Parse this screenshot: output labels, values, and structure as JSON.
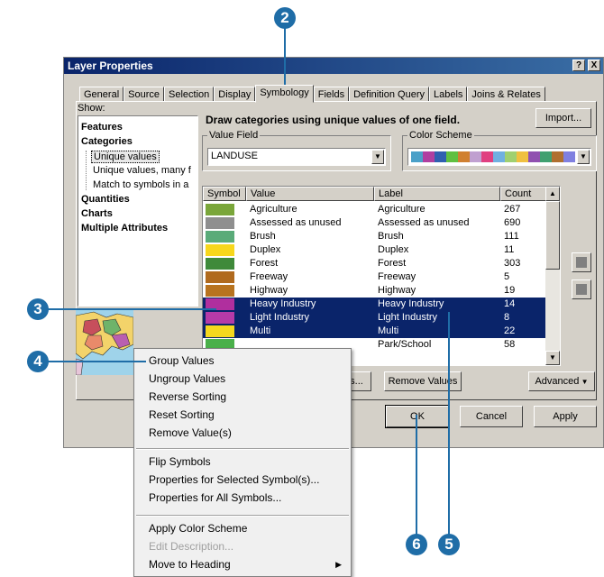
{
  "window": {
    "title": "Layer Properties",
    "help_btn": "?",
    "close_btn": "X"
  },
  "tabs": [
    "General",
    "Source",
    "Selection",
    "Display",
    "Symbology",
    "Fields",
    "Definition Query",
    "Labels",
    "Joins & Relates"
  ],
  "show": {
    "label": "Show:",
    "items": [
      "Features",
      "Categories",
      "Unique values",
      "Unique values, many f",
      "Match to symbols in a",
      "Quantities",
      "Charts",
      "Multiple Attributes"
    ]
  },
  "description": "Draw categories using unique values of one field.",
  "import_label": "Import...",
  "value_field": {
    "label": "Value Field",
    "value": "LANDUSE"
  },
  "color_scheme": {
    "label": "Color Scheme",
    "colors": [
      "#4aa0c8",
      "#b03fa0",
      "#3060b0",
      "#60c040",
      "#d08030",
      "#c0a0d0",
      "#e04080",
      "#70b0e0",
      "#a0d070",
      "#f0c040",
      "#9050b0",
      "#40a070",
      "#b07030",
      "#8080e0"
    ]
  },
  "table": {
    "headers": [
      "Symbol",
      "Value",
      "Label",
      "Count"
    ],
    "rows": [
      {
        "color": "#7aa63a",
        "value": "Agriculture",
        "label": "Agriculture",
        "count": "267",
        "selected": false
      },
      {
        "color": "#8f8f8f",
        "value": "Assessed as unused",
        "label": "Assessed as unused",
        "count": "690",
        "selected": false
      },
      {
        "color": "#5aab79",
        "value": "Brush",
        "label": "Brush",
        "count": "111",
        "selected": false
      },
      {
        "color": "#f7d71c",
        "value": "Duplex",
        "label": "Duplex",
        "count": "11",
        "selected": false
      },
      {
        "color": "#3f8a3a",
        "value": "Forest",
        "label": "Forest",
        "count": "303",
        "selected": false
      },
      {
        "color": "#b06a1e",
        "value": "Freeway",
        "label": "Freeway",
        "count": "5",
        "selected": false
      },
      {
        "color": "#b8731f",
        "value": "Highway",
        "label": "Highway",
        "count": "19",
        "selected": false
      },
      {
        "color": "#b02f9e",
        "value": "Heavy Industry",
        "label": "Heavy Industry",
        "count": "14",
        "selected": true
      },
      {
        "color": "#b63aa8",
        "value": "Light Industry",
        "label": "Light Industry",
        "count": "8",
        "selected": true
      },
      {
        "color": "#f5d81e",
        "value": "Multi",
        "label": "Multi",
        "count": "22",
        "selected": true
      },
      {
        "color": "#4ab04a",
        "value": "",
        "label": "Park/School",
        "count": "58",
        "selected": false
      }
    ]
  },
  "buttons": {
    "add_values_partial": "s...",
    "remove_values": "Remove Values",
    "advanced": "Advanced",
    "ok": "OK",
    "cancel": "Cancel",
    "apply": "Apply"
  },
  "context_menu": {
    "group1": [
      "Group Values",
      "Ungroup Values",
      "Reverse Sorting",
      "Reset Sorting",
      "Remove Value(s)"
    ],
    "group2": [
      "Flip Symbols",
      "Properties for Selected Symbol(s)...",
      "Properties for All Symbols..."
    ],
    "group3": [
      "Apply Color Scheme",
      "Edit Description...",
      "Move to Heading"
    ]
  },
  "callouts": [
    "2",
    "3",
    "4",
    "5",
    "6"
  ]
}
